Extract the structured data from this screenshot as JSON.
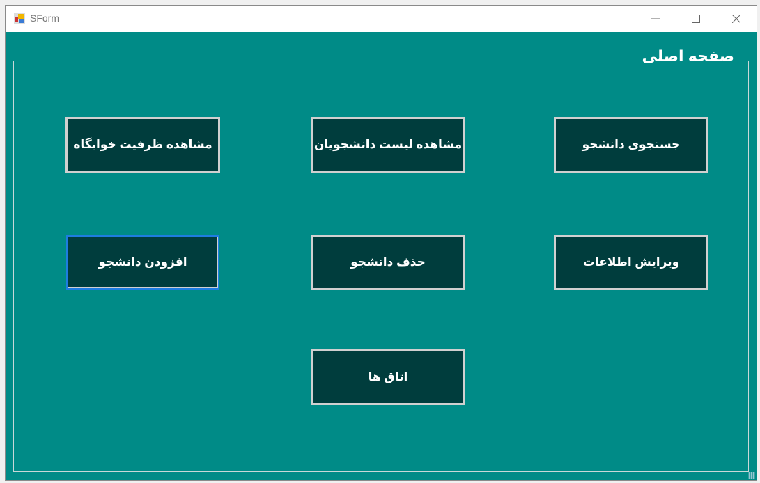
{
  "window": {
    "title": "SForm"
  },
  "group": {
    "title": "صفحه اصلی"
  },
  "buttons": {
    "dorm_capacity": "مشاهده ظرفیت خوابگاه",
    "student_list": "مشاهده لیست دانشجویان",
    "search_student": "جستجوی دانشجو",
    "add_student": "افزودن دانشجو",
    "delete_student": "حذف دانشجو",
    "edit_info": "ویرایش اطلاعات",
    "rooms": "اتاق ها"
  },
  "colors": {
    "background": "#008b87",
    "button": "#003d3d",
    "focus": "#1e7de0"
  }
}
